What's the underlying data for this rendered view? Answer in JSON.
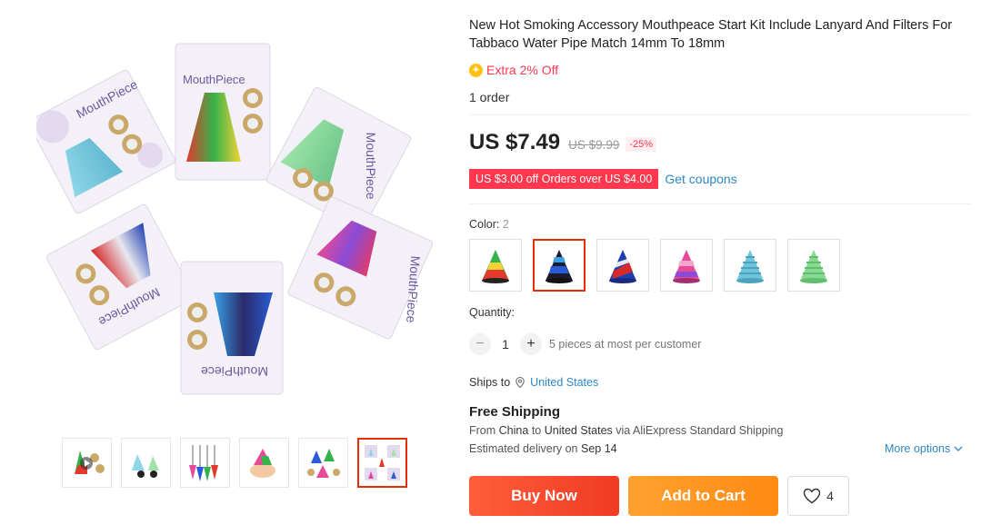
{
  "product": {
    "title": "New Hot Smoking Accessory Mouthpeace Start Kit Include Lanyard And Filters For Tabbaco Water Pipe Match 14mm To 18mm",
    "extra_icon": "✦",
    "extra_off": "Extra 2% Off",
    "orders": "1 order",
    "price": "US $7.49",
    "old_price": "US $9.99",
    "discount": "-25%",
    "coupon": "US $3.00 off Orders over US $4.00",
    "get_coupons": "Get coupons",
    "color_label": "Color: ",
    "color_value": "2",
    "quantity_label": "Quantity:",
    "qty_minus": "−",
    "qty_plus": "+",
    "quantity": "1",
    "qty_note": "5 pieces at most per customer",
    "ships_to_label": "Ships to",
    "ships_country": "United States",
    "free_shipping": "Free Shipping",
    "ship_from_prefix": "From",
    "ship_from_country": "China",
    "ship_to_word": "to",
    "ship_to_country": "United States",
    "ship_via": "via AliExpress Standard Shipping",
    "est_prefix": "Estimated delivery on",
    "est_date": "Sep 14",
    "more_options": "More options",
    "buy_now": "Buy Now",
    "add_to_cart": "Add to Cart",
    "wish_count": "4"
  },
  "image_label": "MouthPiece",
  "colors": {
    "accent": "#e62e04",
    "price_red": "#fd384f",
    "link_blue": "#2e87c7",
    "buy_gradient": "#ef3b23",
    "cart_gradient": "#ff8a14"
  },
  "icons": [
    "play-icon",
    "location-pin-icon",
    "chevron-down-icon",
    "heart-icon",
    "minus-icon",
    "plus-icon"
  ]
}
